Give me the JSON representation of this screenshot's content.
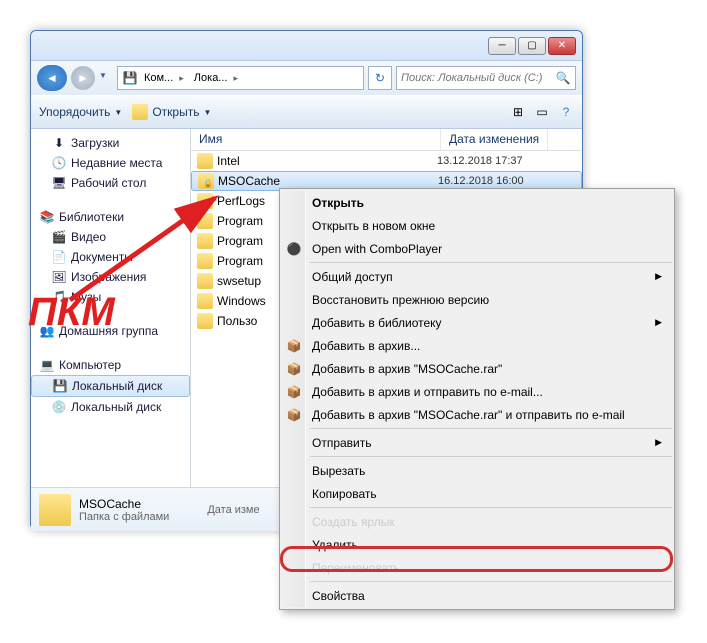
{
  "breadcrumb": {
    "c1": "Ком...",
    "c2": "Лока...",
    "c3": ""
  },
  "search": {
    "placeholder": "Поиск: Локальный диск (C:)"
  },
  "toolbar": {
    "organize": "Упорядочить",
    "open": "Открыть"
  },
  "sidebar": {
    "downloads": "Загрузки",
    "recent": "Недавние места",
    "desktop": "Рабочий стол",
    "libraries": "Библиотеки",
    "videos": "Видео",
    "documents": "Документы",
    "pictures": "Изображения",
    "music": "Музы",
    "homegroup": "Домашняя группа",
    "computer": "Компьютер",
    "localdisk": "Локальный диск",
    "localdisk2": "Локальный диск"
  },
  "columns": {
    "name": "Имя",
    "date": "Дата изменения"
  },
  "files": [
    {
      "name": "Intel",
      "date": "13.12.2018 17:37",
      "lock": false
    },
    {
      "name": "MSOCache",
      "date": "16.12.2018 16:00",
      "lock": true
    },
    {
      "name": "PerfLogs",
      "date": "",
      "lock": false
    },
    {
      "name": "Program",
      "date": "",
      "lock": false
    },
    {
      "name": "Program",
      "date": "",
      "lock": false
    },
    {
      "name": "Program",
      "date": "",
      "lock": false
    },
    {
      "name": "swsetup",
      "date": "",
      "lock": false
    },
    {
      "name": "Windows",
      "date": "",
      "lock": false
    },
    {
      "name": "Пользо",
      "date": "",
      "lock": false
    }
  ],
  "details": {
    "name": "MSOCache",
    "type": "Папка с файлами",
    "datelabel": "Дата изме"
  },
  "ctx": {
    "open": "Открыть",
    "opennew": "Открыть в новом окне",
    "combo": "Open with ComboPlayer",
    "share": "Общий доступ",
    "restore": "Восстановить прежнюю версию",
    "addlib": "Добавить в библиотеку",
    "addarch": "Добавить в архив...",
    "addarch2": "Добавить в архив \"MSOCache.rar\"",
    "addsend": "Добавить в архив и отправить по e-mail...",
    "addsend2": "Добавить в архив \"MSOCache.rar\" и отправить по e-mail",
    "send": "Отправить",
    "cut": "Вырезать",
    "copy": "Копировать",
    "shortcut": "Создать ярлык",
    "delete": "Удалить",
    "rename": "Переименовать",
    "props": "Свойства"
  },
  "annotation": {
    "pkm": "ПКМ"
  }
}
